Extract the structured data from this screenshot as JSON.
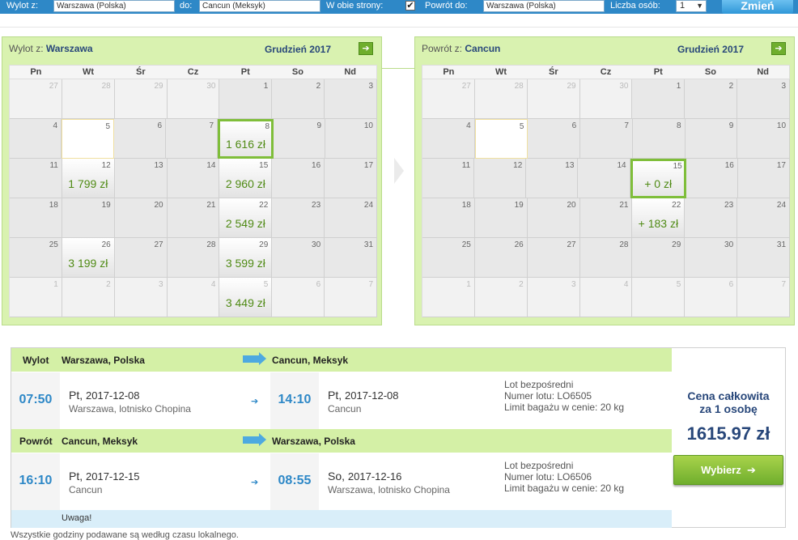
{
  "search": {
    "from_label": "Wylot z:",
    "from_value": "Warszawa (Polska)",
    "to_label": "do:",
    "to_value": "Cancun (Meksyk)",
    "roundtrip_label": "W obie strony:",
    "roundtrip_checked": "✔",
    "return_label": "Powrót do:",
    "return_value": "Warszawa (Polska)",
    "persons_label": "Liczba osób:",
    "persons_value": "1",
    "submit_label": "Zmień"
  },
  "dow": [
    "Pn",
    "Wt",
    "Śr",
    "Cz",
    "Pt",
    "So",
    "Nd"
  ],
  "outbound": {
    "from_prefix": "Wylot z:",
    "from_city": "Warszawa",
    "month": "Grudzień 2017",
    "weeks": [
      [
        {
          "d": "27",
          "o": 1
        },
        {
          "d": "28",
          "o": 1
        },
        {
          "d": "29",
          "o": 1
        },
        {
          "d": "30",
          "o": 1
        },
        {
          "d": "1"
        },
        {
          "d": "2"
        },
        {
          "d": "3"
        }
      ],
      [
        {
          "d": "4"
        },
        {
          "d": "5",
          "w": 1
        },
        {
          "d": "6"
        },
        {
          "d": "7"
        },
        {
          "d": "8",
          "p": "1 616 zł",
          "s": 1
        },
        {
          "d": "9"
        },
        {
          "d": "10"
        }
      ],
      [
        {
          "d": "11"
        },
        {
          "d": "12",
          "p": "1 799 zł"
        },
        {
          "d": "13"
        },
        {
          "d": "14"
        },
        {
          "d": "15",
          "p": "2 960 zł"
        },
        {
          "d": "16"
        },
        {
          "d": "17"
        }
      ],
      [
        {
          "d": "18"
        },
        {
          "d": "19"
        },
        {
          "d": "20"
        },
        {
          "d": "21"
        },
        {
          "d": "22",
          "p": "2 549 zł"
        },
        {
          "d": "23"
        },
        {
          "d": "24"
        }
      ],
      [
        {
          "d": "25"
        },
        {
          "d": "26",
          "p": "3 199 zł"
        },
        {
          "d": "27"
        },
        {
          "d": "28"
        },
        {
          "d": "29",
          "p": "3 599 zł"
        },
        {
          "d": "30"
        },
        {
          "d": "31"
        }
      ],
      [
        {
          "d": "1",
          "o": 1
        },
        {
          "d": "2",
          "o": 1
        },
        {
          "d": "3",
          "o": 1
        },
        {
          "d": "4",
          "o": 1
        },
        {
          "d": "5",
          "o": 1,
          "p": "3 449 zł"
        },
        {
          "d": "6",
          "o": 1
        },
        {
          "d": "7",
          "o": 1
        }
      ]
    ]
  },
  "inbound": {
    "from_prefix": "Powrót z:",
    "from_city": "Cancun",
    "month": "Grudzień 2017",
    "weeks": [
      [
        {
          "d": "27",
          "o": 1
        },
        {
          "d": "28",
          "o": 1
        },
        {
          "d": "29",
          "o": 1
        },
        {
          "d": "30",
          "o": 1
        },
        {
          "d": "1"
        },
        {
          "d": "2"
        },
        {
          "d": "3"
        }
      ],
      [
        {
          "d": "4"
        },
        {
          "d": "5",
          "w": 1
        },
        {
          "d": "6"
        },
        {
          "d": "7"
        },
        {
          "d": "8"
        },
        {
          "d": "9"
        },
        {
          "d": "10"
        }
      ],
      [
        {
          "d": "11"
        },
        {
          "d": "12"
        },
        {
          "d": "13"
        },
        {
          "d": "14"
        },
        {
          "d": "15",
          "p": "+ 0 zł",
          "s": 1
        },
        {
          "d": "16"
        },
        {
          "d": "17"
        }
      ],
      [
        {
          "d": "18"
        },
        {
          "d": "19"
        },
        {
          "d": "20"
        },
        {
          "d": "21"
        },
        {
          "d": "22",
          "p": "+ 183 zł"
        },
        {
          "d": "23"
        },
        {
          "d": "24"
        }
      ],
      [
        {
          "d": "25"
        },
        {
          "d": "26"
        },
        {
          "d": "27"
        },
        {
          "d": "28"
        },
        {
          "d": "29"
        },
        {
          "d": "30"
        },
        {
          "d": "31"
        }
      ],
      [
        {
          "d": "1",
          "o": 1
        },
        {
          "d": "2",
          "o": 1
        },
        {
          "d": "3",
          "o": 1
        },
        {
          "d": "4",
          "o": 1
        },
        {
          "d": "5",
          "o": 1
        },
        {
          "d": "6",
          "o": 1
        },
        {
          "d": "7",
          "o": 1
        }
      ]
    ]
  },
  "summary": {
    "out": {
      "label": "Wylot",
      "from": "Warszawa, Polska",
      "to": "Cancun, Meksyk",
      "dep_time": "07:50",
      "dep_day": "Pt,",
      "dep_date": "2017-12-08",
      "dep_place": "Warszawa, lotnisko Chopina",
      "arr_time": "14:10",
      "arr_day": "Pt,",
      "arr_date": "2017-12-08",
      "arr_place": "Cancun",
      "info1": "Lot bezpośredni",
      "info2": "Numer lotu: LO6505",
      "info3": "Limit bagażu w cenie: 20 kg"
    },
    "ret": {
      "label": "Powrót",
      "from": "Cancun, Meksyk",
      "to": "Warszawa, Polska",
      "dep_time": "16:10",
      "dep_day": "Pt,",
      "dep_date": "2017-12-15",
      "dep_place": "Cancun",
      "arr_time": "08:55",
      "arr_day": "So,",
      "arr_date": "2017-12-16",
      "arr_place": "Warszawa, lotnisko Chopina",
      "info1": "Lot bezpośredni",
      "info2": "Numer lotu: LO6506",
      "info3": "Limit bagażu w cenie: 20 kg"
    },
    "warning": "Uwaga!",
    "total_line1": "Cena całkowita",
    "total_line2": "za 1 osobę",
    "total_price": "1615.97 zł",
    "choose_label": "Wybierz",
    "arrow": "➔"
  },
  "footer": "Wszystkie godziny podawane są według czasu lokalnego."
}
